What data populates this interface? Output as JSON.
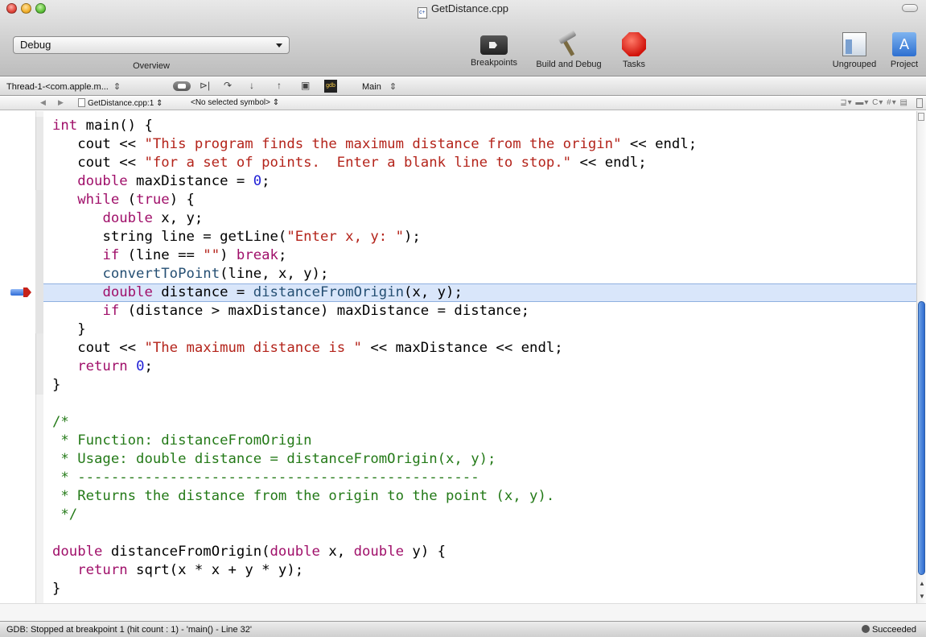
{
  "window": {
    "title": "GetDistance.cpp",
    "file_badge": "c+"
  },
  "toolbar": {
    "config_value": "Debug",
    "overview_label": "Overview",
    "breakpoints_label": "Breakpoints",
    "build_debug_label": "Build and Debug",
    "tasks_label": "Tasks",
    "ungrouped_label": "Ungrouped",
    "project_label": "Project",
    "project_glyph": "A"
  },
  "debugger": {
    "thread_value": "Thread-1-<com.apple.m...",
    "gdb_label": "gdb",
    "frame_value": "Main",
    "stepper_glyph": "⇕",
    "buttons": [
      "⊳|",
      "↷",
      "↓",
      "↑",
      "▣"
    ]
  },
  "navbar": {
    "file_value": "GetDistance.cpp:1 ⇕",
    "symbol_value": "<No selected symbol> ⇕",
    "tools": "⊒▾ ▬▾ C▾ #▾ ▤"
  },
  "code": {
    "lines": [
      {
        "indent": 0,
        "tokens": [
          [
            "kw",
            "int"
          ],
          [
            "plain",
            " main() {"
          ]
        ]
      },
      {
        "indent": 1,
        "tokens": [
          [
            "plain",
            "cout << "
          ],
          [
            "str",
            "\"This program finds the maximum distance from the origin\""
          ],
          [
            "plain",
            " << endl;"
          ]
        ]
      },
      {
        "indent": 1,
        "tokens": [
          [
            "plain",
            "cout << "
          ],
          [
            "str",
            "\"for a set of points.  Enter a blank line to stop.\""
          ],
          [
            "plain",
            " << endl;"
          ]
        ]
      },
      {
        "indent": 1,
        "tokens": [
          [
            "kw",
            "double"
          ],
          [
            "plain",
            " maxDistance = "
          ],
          [
            "num",
            "0"
          ],
          [
            "plain",
            ";"
          ]
        ]
      },
      {
        "indent": 1,
        "tokens": [
          [
            "kw",
            "while"
          ],
          [
            "plain",
            " ("
          ],
          [
            "kw",
            "true"
          ],
          [
            "plain",
            ") {"
          ]
        ]
      },
      {
        "indent": 2,
        "tokens": [
          [
            "kw",
            "double"
          ],
          [
            "plain",
            " x, y;"
          ]
        ]
      },
      {
        "indent": 2,
        "tokens": [
          [
            "plain",
            "string line = getLine("
          ],
          [
            "str",
            "\"Enter x, y: \""
          ],
          [
            "plain",
            ");"
          ]
        ]
      },
      {
        "indent": 2,
        "tokens": [
          [
            "kw",
            "if"
          ],
          [
            "plain",
            " (line == "
          ],
          [
            "str",
            "\"\""
          ],
          [
            "plain",
            ") "
          ],
          [
            "kw",
            "break"
          ],
          [
            "plain",
            ";"
          ]
        ]
      },
      {
        "indent": 2,
        "tokens": [
          [
            "fn",
            "convertToPoint"
          ],
          [
            "plain",
            "(line, x, y);"
          ]
        ]
      },
      {
        "indent": 2,
        "highlight": true,
        "tokens": [
          [
            "kw",
            "double"
          ],
          [
            "plain",
            " distance = "
          ],
          [
            "fn",
            "distanceFromOrigin"
          ],
          [
            "plain",
            "(x, y);"
          ]
        ]
      },
      {
        "indent": 2,
        "tokens": [
          [
            "kw",
            "if"
          ],
          [
            "plain",
            " (distance > maxDistance) maxDistance = distance;"
          ]
        ]
      },
      {
        "indent": 1,
        "tokens": [
          [
            "plain",
            "}"
          ]
        ]
      },
      {
        "indent": 1,
        "tokens": [
          [
            "plain",
            "cout << "
          ],
          [
            "str",
            "\"The maximum distance is \""
          ],
          [
            "plain",
            " << maxDistance << endl;"
          ]
        ]
      },
      {
        "indent": 1,
        "tokens": [
          [
            "kw",
            "return"
          ],
          [
            "plain",
            " "
          ],
          [
            "num",
            "0"
          ],
          [
            "plain",
            ";"
          ]
        ]
      },
      {
        "indent": 0,
        "tokens": [
          [
            "plain",
            "}"
          ]
        ]
      },
      {
        "indent": 0,
        "tokens": []
      },
      {
        "indent": 0,
        "tokens": [
          [
            "cm",
            "/*"
          ]
        ]
      },
      {
        "indent": 0,
        "tokens": [
          [
            "cm",
            " * Function: distanceFromOrigin"
          ]
        ]
      },
      {
        "indent": 0,
        "tokens": [
          [
            "cm",
            " * Usage: double distance = distanceFromOrigin(x, y);"
          ]
        ]
      },
      {
        "indent": 0,
        "tokens": [
          [
            "cm",
            " * ------------------------------------------------"
          ]
        ]
      },
      {
        "indent": 0,
        "tokens": [
          [
            "cm",
            " * Returns the distance from the origin to the point (x, y)."
          ]
        ]
      },
      {
        "indent": 0,
        "tokens": [
          [
            "cm",
            " */"
          ]
        ]
      },
      {
        "indent": 0,
        "tokens": []
      },
      {
        "indent": 0,
        "tokens": [
          [
            "kw",
            "double"
          ],
          [
            "plain",
            " distanceFromOrigin("
          ],
          [
            "kw",
            "double"
          ],
          [
            "plain",
            " x, "
          ],
          [
            "kw",
            "double"
          ],
          [
            "plain",
            " y) {"
          ]
        ]
      },
      {
        "indent": 1,
        "tokens": [
          [
            "kw",
            "return"
          ],
          [
            "plain",
            " sqrt(x * x + y * y);"
          ]
        ]
      },
      {
        "indent": 0,
        "tokens": [
          [
            "plain",
            "}"
          ]
        ]
      }
    ]
  },
  "status": {
    "text": "GDB: Stopped at breakpoint 1 (hit count : 1) - 'main() - Line 32'",
    "build_result": "Succeeded"
  }
}
